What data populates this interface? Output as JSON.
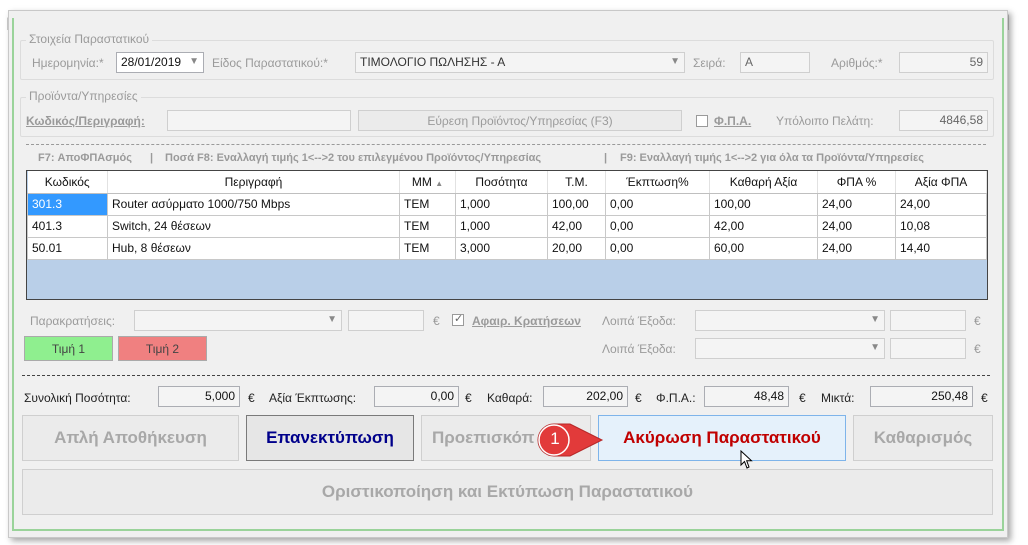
{
  "header": {
    "group_title": "Στοιχεία Παραστατικού",
    "date_label": "Ημερομηνία:*",
    "date_value": "28/01/2019",
    "doctype_label": "Είδος Παραστατικού:*",
    "doctype_value": "ΤΙΜΟΛΟΓΙΟ ΠΩΛΗΣΗΣ - Α",
    "series_label": "Σειρά:",
    "series_value": "Α",
    "number_label": "Αριθμός:*",
    "number_value": "59"
  },
  "products": {
    "group_title": "Προϊόντα/Υπηρεσίες",
    "code_label": "Κωδικός/Περιγραφή:",
    "code_value": "",
    "find_button": "Εύρεση Προϊόντος/Υπηρεσίας (F3)",
    "vat_label": "Φ.Π.Α.",
    "balance_label": "Υπόλοιπο Πελάτη:",
    "balance_value": "4846,58"
  },
  "hints": {
    "f7": "F7: ΑποΦΠΑσμός",
    "f8": "Ποσά F8: Εναλλαγή τιμής 1<-->2 του επιλεγμένου Προϊόντος/Υπηρεσίας",
    "f9": "F9: Εναλλαγή τιμής 1<-->2 για όλα τα Προϊόντα/Υπηρεσίες"
  },
  "grid": {
    "columns": [
      "Κωδικός",
      "Περιγραφή",
      "ΜΜ",
      "Ποσότητα",
      "Τ.Μ.",
      "Έκπτωση%",
      "Καθαρή Αξία",
      "ΦΠΑ %",
      "Αξία ΦΠΑ"
    ],
    "rows": [
      [
        "301.3",
        "Router ασύρματο 1000/750 Mbps",
        "TEM",
        "1,000",
        "100,00",
        "0,00",
        "100,00",
        "24,00",
        "24,00"
      ],
      [
        "401.3",
        "Switch, 24 θέσεων",
        "TEM",
        "1,000",
        "42,00",
        "0,00",
        "42,00",
        "24,00",
        "10,08"
      ],
      [
        "50.01",
        "Hub, 8 θέσεων",
        "TEM",
        "3,000",
        "20,00",
        "0,00",
        "60,00",
        "24,00",
        "14,40"
      ]
    ]
  },
  "deductions": {
    "label": "Παρακρατήσεις:",
    "euro": "€",
    "subtract_label": "Αφαιρ. Κρατήσεων",
    "other1_label": "Λοιπά Έξοδα:",
    "other2_label": "Λοιπά Έξοδα:"
  },
  "price_buttons": {
    "price1": "Τιμή 1",
    "price2": "Τιμή 2",
    "price1_color": "#8fef8f",
    "price2_color": "#f08080"
  },
  "totals": {
    "qty_label": "Συνολική Ποσότητα:",
    "qty_value": "5,000",
    "discount_label": "Αξία Έκπτωσης:",
    "discount_value": "0,00",
    "net_label": "Καθαρά:",
    "net_value": "202,00",
    "vat_label": "Φ.Π.Α.:",
    "vat_value": "48,48",
    "gross_label": "Μικτά:",
    "gross_value": "250,48",
    "euro": "€"
  },
  "actions": {
    "simple_save": "Απλή Αποθήκευση",
    "reprint": "Επανεκτύπωση",
    "preview": "Προεπισκόπ",
    "cancel_doc": "Ακύρωση Παραστατικού",
    "clear": "Καθαρισμός",
    "finalize": "Οριστικοποίηση και Εκτύπωση Παραστατικού",
    "reprint_color": "#00008b",
    "cancel_color": "#c00000"
  },
  "callout": {
    "number": "1",
    "color": "#e23a3a"
  }
}
